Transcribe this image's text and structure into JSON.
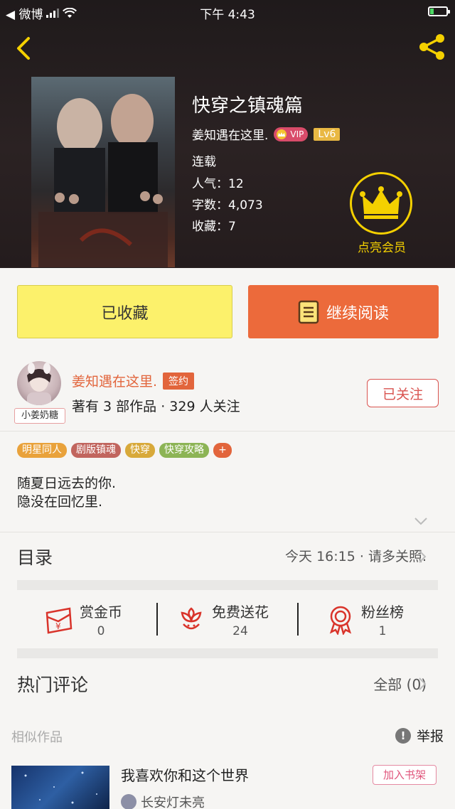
{
  "status_bar": {
    "back_app": "◀ 微博",
    "time": "下午 4:43"
  },
  "book": {
    "title": "快穿之镇魂篇",
    "author": "姜知遇在这里.",
    "vip_label": "VIP",
    "level": "Lv6",
    "status": "连载",
    "popularity": "人气：12",
    "word_count": "字数：4,073",
    "favorites": "收藏：7"
  },
  "member": {
    "label": "点亮会员"
  },
  "actions": {
    "favorited_label": "已收藏",
    "continue_label": "继续阅读"
  },
  "author_card": {
    "avatar_tag": "小姜奶糖",
    "name": "姜知遇在这里.",
    "sign_badge": "签约",
    "stats": "著有 3 部作品 · 329 人关注",
    "follow_label": "已关注"
  },
  "tags": [
    {
      "label": "明星同人",
      "color": "#e9a23b"
    },
    {
      "label": "剧版镇魂",
      "color": "#c1655e"
    },
    {
      "label": "快穿",
      "color": "#d8a93a"
    },
    {
      "label": "快穿攻略",
      "color": "#8cb455"
    }
  ],
  "tag_add": "+",
  "description": {
    "line1": "随夏日远去的你.",
    "line2": "隐没在回忆里."
  },
  "toc": {
    "label": "目录",
    "latest": "今天 16:15 · 请多关照."
  },
  "stats": {
    "reward": {
      "label": "赏金币",
      "value": "0"
    },
    "flowers": {
      "label": "免费送花",
      "value": "24"
    },
    "fans": {
      "label": "粉丝榜",
      "value": "1"
    }
  },
  "comments": {
    "label": "热门评论",
    "all": "全部 (0)"
  },
  "similar": {
    "label": "相似作品",
    "report": "举报",
    "report_icon": "!",
    "item": {
      "title": "我喜欢你和这个世界",
      "author": "长安灯未亮",
      "add_label": "加入书架"
    }
  },
  "colors": {
    "accent_orange": "#ec6a3b",
    "fav_yellow": "#fcf16b",
    "crown_gold": "#f4d000"
  }
}
